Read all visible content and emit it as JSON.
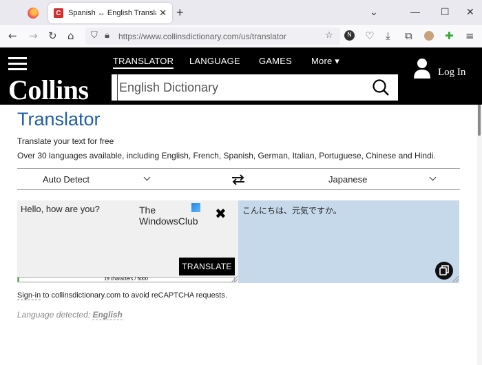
{
  "browser": {
    "tab_title": "Spanish ↔ English Translator | C",
    "tab_favicon": "C",
    "new_tab": "+",
    "url": "https://www.collinsdictionary.com/us/translator",
    "account_badge": "N"
  },
  "header": {
    "logo": "Collins",
    "menu": [
      "TRANSLATOR",
      "LANGUAGE",
      "GAMES",
      "More"
    ],
    "search_placeholder": "English Dictionary",
    "login": "Log In"
  },
  "page": {
    "title": "Translator",
    "line1": "Translate your text for free",
    "line2": "Over 30 languages available, including English, French, Spanish, German, Italian, Portuguese, Chinese and Hindi."
  },
  "translator": {
    "source_language": "Auto Detect",
    "target_language": "Japanese",
    "source_text": "Hello, how are you?",
    "watermark_line1": "The",
    "watermark_line2": "WindowsClub",
    "translate_label": "TRANSLATE",
    "char_count": "19 characters / 5000",
    "char_fraction": 0.0038,
    "target_text": "こんにちは、元気ですか。"
  },
  "footer": {
    "signin_link": "Sign-in",
    "signin_rest": " to collinsdictionary.com to avoid reCAPTCHA requests.",
    "detected_label": "Language detected:",
    "detected_value": "English"
  },
  "colors": {
    "brand_black": "#000000",
    "title_blue": "#1f5fa8",
    "target_panel": "#c5d9eb",
    "source_panel": "#f0f0f0"
  }
}
